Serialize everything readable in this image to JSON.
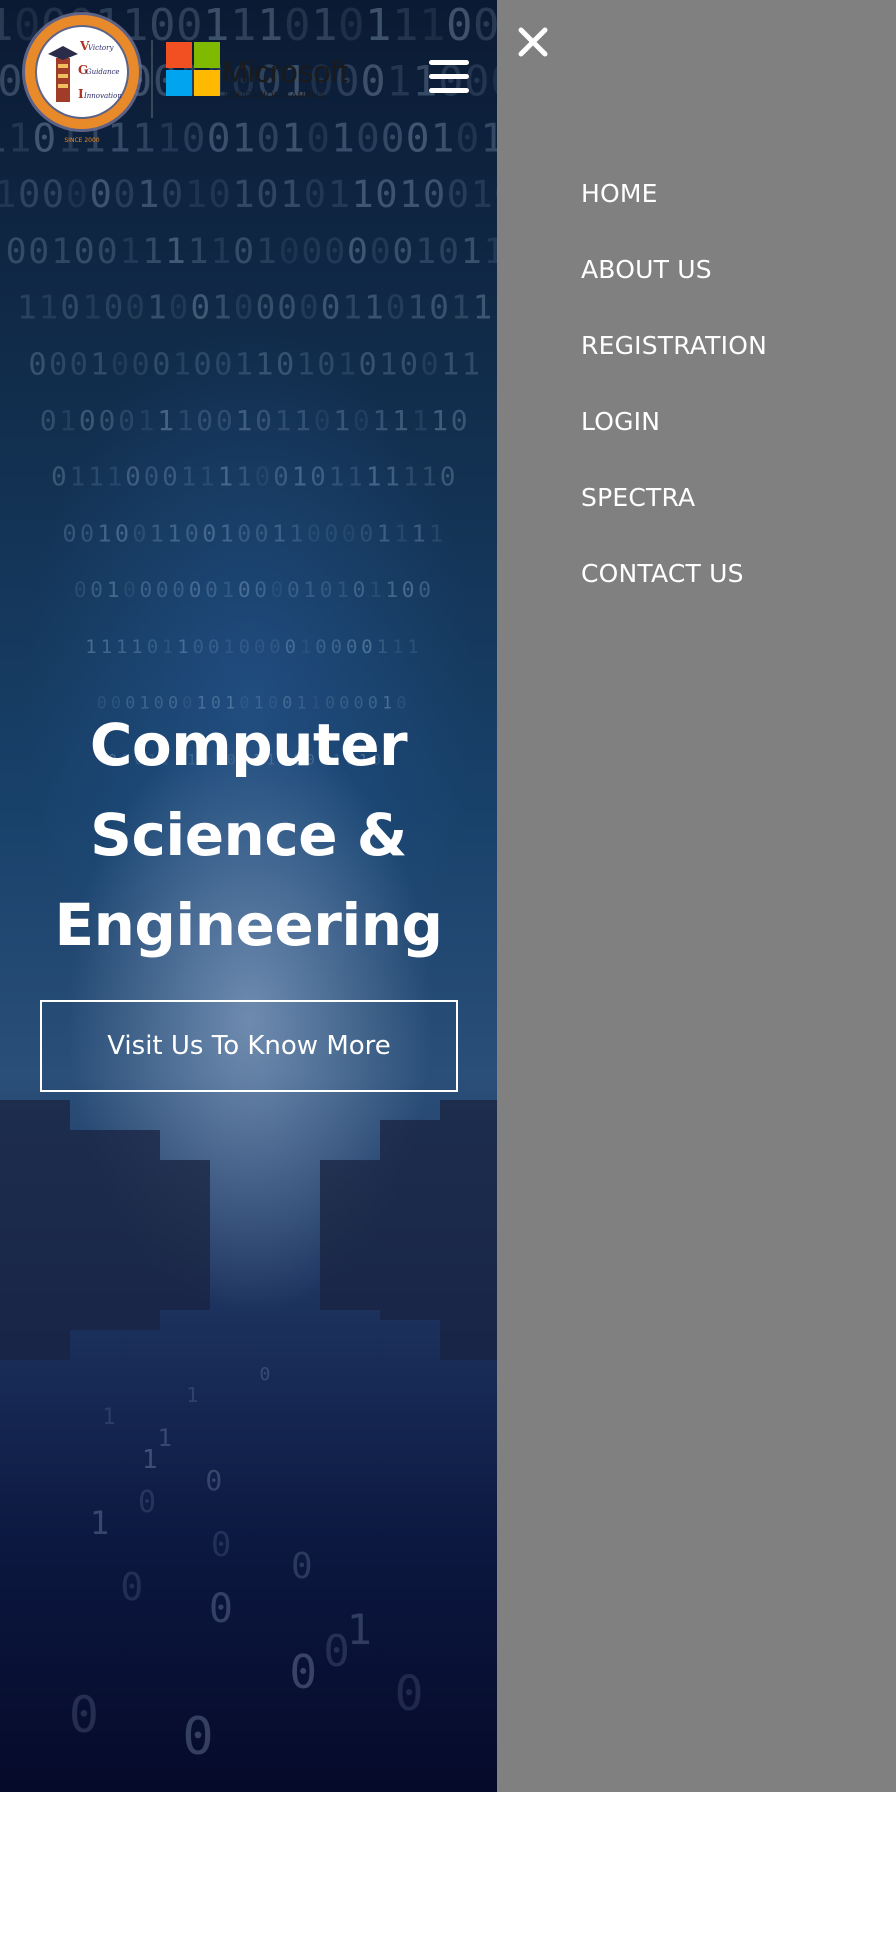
{
  "header": {
    "logo": {
      "seal_words": [
        "Victory",
        "Guidance",
        "Innovation"
      ],
      "seal_initials": [
        "V",
        "G",
        "I"
      ],
      "since": "SINCE 2000"
    },
    "partner": {
      "name": "Microsoft",
      "tagline": "EDUCATION CAMPUS"
    },
    "menu_icon": "hamburger-icon"
  },
  "hero": {
    "title_lines": [
      "Computer",
      "Science &",
      "Engineering"
    ],
    "cta_label": "Visit Us To Know More"
  },
  "drawer": {
    "close_icon": "close-icon",
    "items": [
      {
        "label": "HOME"
      },
      {
        "label": "ABOUT US"
      },
      {
        "label": "REGISTRATION"
      },
      {
        "label": "LOGIN"
      },
      {
        "label": "SPECTRA"
      },
      {
        "label": "CONTACT US"
      }
    ]
  },
  "colors": {
    "drawer_bg": "#808080",
    "hero_dark": "#050a2a",
    "hero_mid": "#18416a",
    "seal_orange": "#e8892a",
    "seal_ring": "#6b6f94",
    "ms_red": "#f25022",
    "ms_green": "#7fba00",
    "ms_blue": "#00a4ef",
    "ms_yellow": "#ffb900"
  }
}
